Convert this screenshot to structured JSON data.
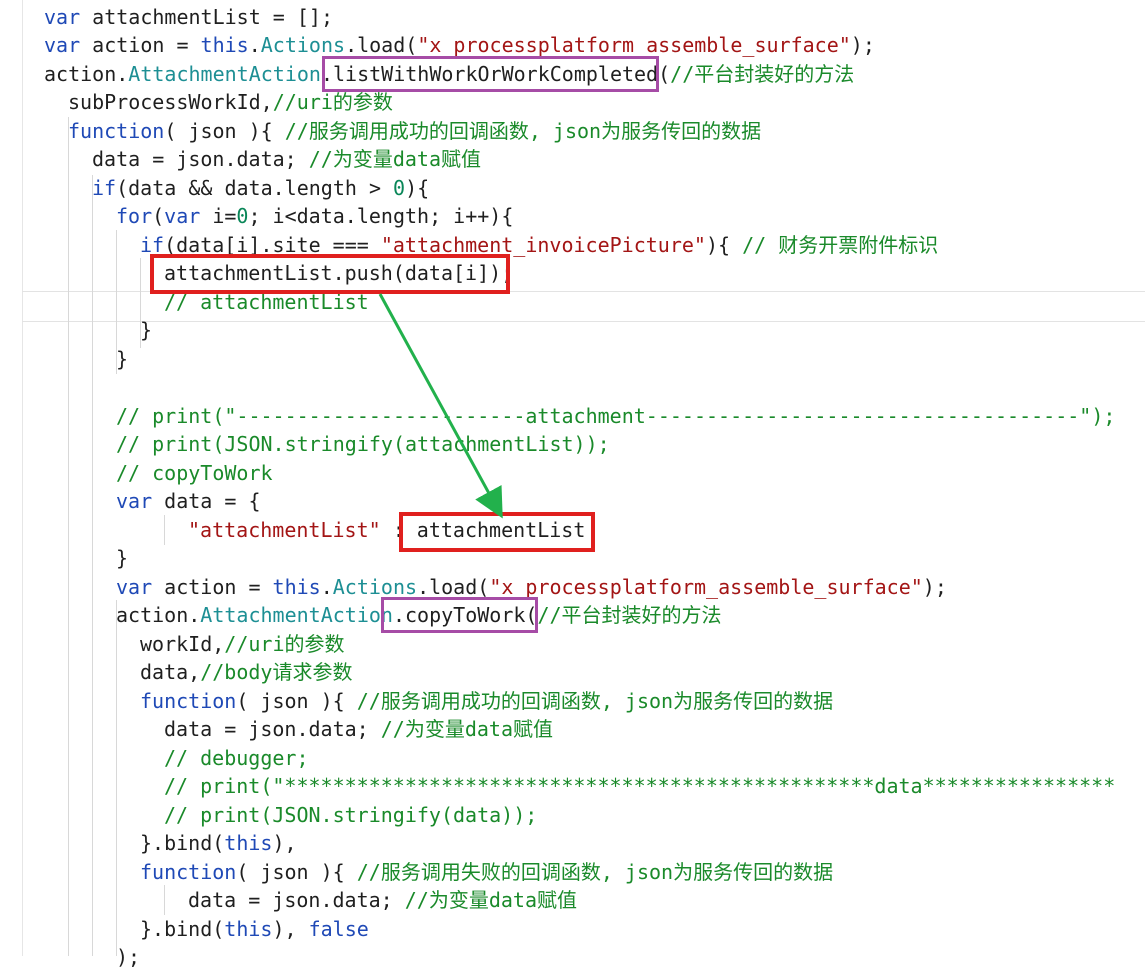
{
  "code_lines": [
    "var attachmentList = [];",
    "var action = this.Actions.load(\"x_processplatform_assemble_surface\");",
    "action.AttachmentAction.listWithWorkOrWorkCompleted(//平台封装好的方法",
    "subProcessWorkId,//uri的参数",
    "function( json ){ //服务调用成功的回调函数, json为服务传回的数据",
    "data = json.data; //为变量data赋值",
    "if(data && data.length > 0){",
    "for(var i=0; i<data.length; i++){",
    "if(data[i].site === \"attachment_invoicePicture\"){ // 财务开票附件标识",
    "attachmentList.push(data[i]);",
    "// attachmentList",
    "}",
    "}",
    "",
    "// print(\"------------------------attachment------------------------------------\");",
    "// print(JSON.stringify(attachmentList));",
    "// copyToWork",
    "var data = {",
    "\"attachmentList\" : attachmentList",
    "}",
    "var action = this.Actions.load(\"x_processplatform_assemble_surface\");",
    "action.AttachmentAction.copyToWork(//平台封装好的方法",
    "workId,//uri的参数",
    "data,//body请求参数",
    "function( json ){ //服务调用成功的回调函数, json为服务传回的数据",
    "data = json.data; //为变量data赋值",
    "// debugger;",
    "// print(\"*************************************************data****************",
    "// print(JSON.stringify(data));",
    "}.bind(this),",
    "function( json ){ //服务调用失败的回调函数, json为服务传回的数据",
    "data = json.data; //为变量data赋值",
    "}.bind(this), false",
    ");"
  ],
  "colors": {
    "keyword": "#1f49b6",
    "type": "#1d8f94",
    "string": "#a31515",
    "comment": "#1a8a2a",
    "highlight_purple": "#a64ca6",
    "highlight_red": "#e0201e",
    "arrow": "#22b14c"
  }
}
